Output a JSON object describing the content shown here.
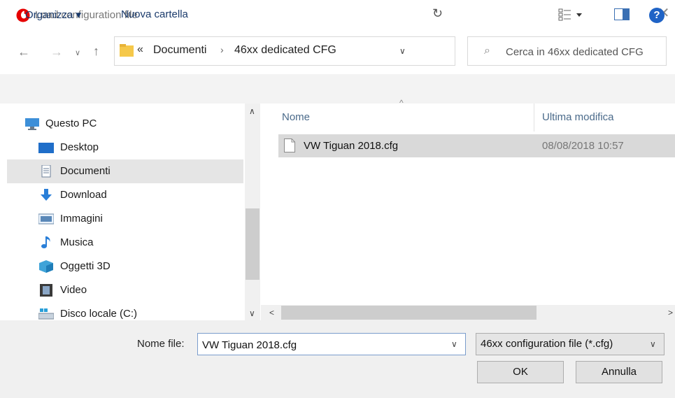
{
  "dialog": {
    "title": "Load configuration file",
    "brand_color": "#e60000"
  },
  "address": {
    "prefix": "«",
    "crumbs": [
      "Documenti",
      "46xx dedicated CFG"
    ],
    "separator": "›"
  },
  "search": {
    "placeholder": "Cerca in 46xx dedicated CFG"
  },
  "toolbar": {
    "organize_label": "Organizza ▾",
    "new_folder_label": "Nuova cartella"
  },
  "nav": {
    "items": [
      {
        "label": "Questo PC",
        "icon": "pc-icon"
      },
      {
        "label": "Desktop",
        "icon": "desktop-icon"
      },
      {
        "label": "Documenti",
        "icon": "documents-icon",
        "selected": true
      },
      {
        "label": "Download",
        "icon": "download-icon"
      },
      {
        "label": "Immagini",
        "icon": "pictures-icon"
      },
      {
        "label": "Musica",
        "icon": "music-icon"
      },
      {
        "label": "Oggetti 3D",
        "icon": "objects-3d-icon"
      },
      {
        "label": "Video",
        "icon": "video-icon"
      },
      {
        "label": "Disco locale (C:)",
        "icon": "drive-icon"
      }
    ]
  },
  "files": {
    "columns": [
      "Nome",
      "Ultima modifica"
    ],
    "rows": [
      {
        "name": "VW Tiguan 2018.cfg",
        "modified": "08/08/2018 10:57",
        "selected": true
      }
    ]
  },
  "footer": {
    "filename_label": "Nome file:",
    "filename_value": "VW Tiguan 2018.cfg",
    "filetype": "46xx configuration file (*.cfg)",
    "ok_label": "OK",
    "cancel_label": "Annulla"
  }
}
